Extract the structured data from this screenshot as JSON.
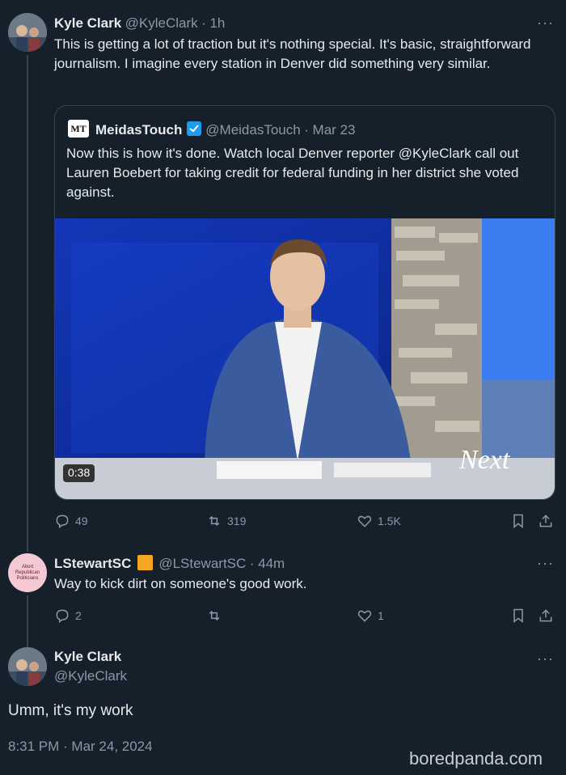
{
  "tweet1": {
    "name": "Kyle Clark",
    "handle": "@KyleClark",
    "time": "· 1h",
    "text": "This is getting a lot of traction but it's nothing special. It's basic, straightforward journalism. I imagine every station in Denver did something very similar.",
    "quote": {
      "logo_text": "MT",
      "name": "MeidasTouch",
      "handle": "@MeidasTouch",
      "time": "· Mar 23",
      "text": "Now this is how it's done. Watch local Denver reporter @KyleClark call out Lauren Boebert for taking credit for federal funding in her district she voted against.",
      "video_duration": "0:38",
      "watermark": "Next"
    },
    "actions": {
      "replies": "49",
      "retweets": "319",
      "likes": "1.5K"
    }
  },
  "reply": {
    "avatar_text": "Abort Republican Politicians",
    "name": "LStewartSC",
    "handle": "@LStewartSC",
    "time": "· 44m",
    "text": "Way to kick dirt on someone's good work.",
    "actions": {
      "replies": "2",
      "retweets": "",
      "likes": "1"
    }
  },
  "tweet3": {
    "name": "Kyle Clark",
    "handle": "@KyleClark",
    "text": "Umm, it's my work",
    "timestamp": "8:31 PM · Mar 24, 2024"
  },
  "watermark_site": "boredpanda.com",
  "colors": {
    "bg": "#15202b",
    "muted": "#8b98a5",
    "accent": "#1d9bf0",
    "border": "#38444d"
  }
}
